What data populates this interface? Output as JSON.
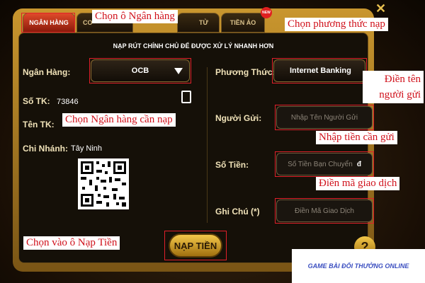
{
  "tabs": {
    "bank": "NGÂN HÀNG",
    "tab2": "CO",
    "tab3": "TỬ",
    "crypto": "TIỀN ẢO"
  },
  "badge": {
    "new": "NEW"
  },
  "headline": "NẠP RÚT CHÍNH CHỦ ĐỂ ĐƯỢC XỬ LÝ NHANH HƠN",
  "left": {
    "bank_label": "Ngân Hàng:",
    "bank_value": "OCB",
    "account_label": "Số TK:",
    "account_value": "73846",
    "name_label": "Tên TK:",
    "branch_label": "Chi Nhánh:",
    "branch_value": "Tây Ninh"
  },
  "right": {
    "method_label": "Phương Thức:",
    "method_value": "Internet Banking",
    "sender_label": "Người Gửi:",
    "sender_placeholder": "Nhập Tên Người Gửi",
    "amount_label": "Số Tiền:",
    "amount_placeholder": "Số Tiền Bạn Chuyển",
    "amount_unit": "đ",
    "note_label": "Ghi Chú (*)",
    "note_placeholder": "Điền Mã Giao Dịch"
  },
  "submit_label": "NẠP TIỀN",
  "help_label": "?",
  "annotations": {
    "choose_bank_tab": "Chọn ô Ngân hàng",
    "choose_method": "Chọn phương thức nạp",
    "sender_name": "Điền tên người gửi",
    "choose_bank": "Chọn Ngân hàng cần nạp",
    "enter_amount": "Nhập tiền cần gửi",
    "enter_code": "Điền mã giao dịch",
    "click_deposit": "Chọn vào ô Nạp Tiền"
  },
  "brand": "GAME BÀI ĐỔI THƯỞNG ONLINE",
  "colors": {
    "accent": "#e0202a",
    "gold": "#c9962e"
  }
}
